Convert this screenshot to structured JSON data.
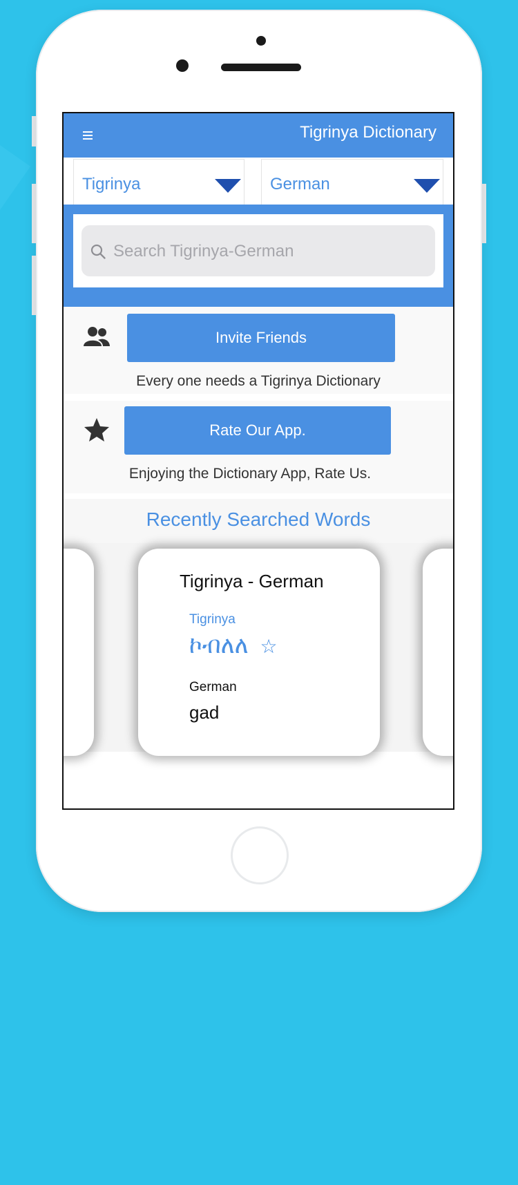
{
  "header": {
    "menu_icon": "hamburger-menu-icon",
    "title": "Tigrinya Dictionary"
  },
  "languages": {
    "from": {
      "label": "Tigrinya",
      "icon": "dropdown-caret-icon"
    },
    "to": {
      "label": "German",
      "icon": "dropdown-caret-icon"
    }
  },
  "search": {
    "placeholder": "Search Tigrinya-German",
    "value": "",
    "icon": "search-icon"
  },
  "invite": {
    "icon": "users-icon",
    "button_label": "Invite Friends",
    "caption": "Every one needs a Tigrinya Dictionary"
  },
  "rate": {
    "icon": "star-icon",
    "button_label": "Rate Our App.",
    "caption": "Enjoying the Dictionary App, Rate Us."
  },
  "recent": {
    "title": "Recently Searched Words",
    "card": {
      "heading": "Tigrinya - German",
      "source_label": "Tigrinya",
      "source_word": "ኮብለለ",
      "favorite_icon": "☆",
      "target_label": "German",
      "target_word": "gad"
    }
  },
  "colors": {
    "primary": "#4a90e2",
    "caret": "#1f4fae",
    "background": "#2ec2ea"
  }
}
